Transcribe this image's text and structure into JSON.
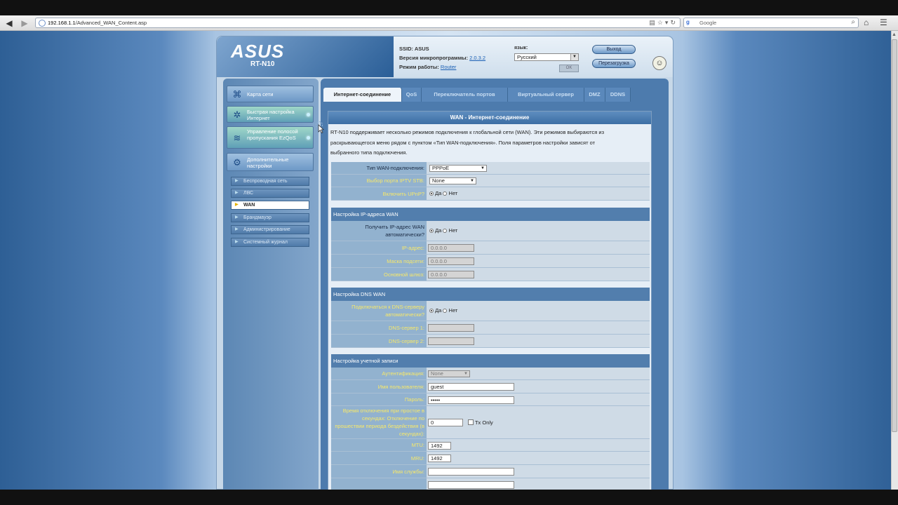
{
  "browser": {
    "url_host": "192.168.1.1",
    "url_path": "/Advanced_WAN_Content.asp",
    "search_placeholder": "Google",
    "search_engine_letter": "g"
  },
  "router": {
    "brand": "ASUS",
    "model": "RT-N10",
    "ssid_label": "SSID:",
    "ssid_value": "ASUS",
    "firmware_label": "Версия микропрограммы:",
    "firmware_value": "2.0.3.2",
    "mode_label": "Режим работы:",
    "mode_value": "Router",
    "language_label": "язык:",
    "language_value": "Русский",
    "apply_label": "OK",
    "logout_label": "Выход",
    "reboot_label": "Перезагрузка"
  },
  "sidebar": {
    "main": [
      {
        "label": "Карта сети",
        "icon": "network-map-icon"
      },
      {
        "label": "Быстрая настройка Интернет",
        "icon": "quick-setup-icon"
      },
      {
        "label": "Управление полосой пропускания EzQoS",
        "icon": "qos-icon"
      },
      {
        "label": "Дополнительные настройки",
        "icon": "advanced-settings-icon"
      }
    ],
    "sub": [
      {
        "label": "Беспроводная сеть"
      },
      {
        "label": "ЛВС"
      },
      {
        "label": "WAN"
      },
      {
        "label": "Брандмауэр"
      },
      {
        "label": "Администрирование"
      },
      {
        "label": "Системный журнал"
      }
    ]
  },
  "tabs": [
    {
      "label": "Интернет-соединение"
    },
    {
      "label": "QoS"
    },
    {
      "label": "Переключатель портов"
    },
    {
      "label": "Виртуальный сервер"
    },
    {
      "label": "DMZ"
    },
    {
      "label": "DDNS"
    }
  ],
  "panel": {
    "title": "WAN - Интернет-соединение",
    "desc_line1": "RT-N10 поддерживает несколько режимов подключения к глобальной сети (WAN). Эти режимов выбираются из",
    "desc_line2": "раскрывающегося меню рядом с пунктом «Тип WAN-подключения». Поля параметров настройки зависят от",
    "desc_line3": "выбранного типа подключения.",
    "wan_type_label": "Тип WAN-подключения:",
    "wan_type_value": "PPPoE",
    "iptv_label": "Выбор порта IPTV STB:",
    "iptv_value": "None",
    "upnp_label": "Включить UPnP?",
    "yes": "Да",
    "no": "Нет",
    "ip_section": "Настройка IP-адреса WAN",
    "auto_ip_label": "Получить IP-адрес WAN автоматически?",
    "ip_label": "IP-адрес:",
    "ip_value": "0.0.0.0",
    "mask_label": "Маска подсети:",
    "mask_value": "0.0.0.0",
    "gateway_label": "Основной шлюз:",
    "gateway_value": "0.0.0.0",
    "dns_section": "Настройка DNS WAN",
    "auto_dns_label": "Подключаться к DNS-серверу автоматически?",
    "dns1_label": "DNS-сервер 1:",
    "dns1_value": "",
    "dns2_label": "DNS-сервер 2:",
    "dns2_value": "",
    "account_section": "Настройка учетной записи",
    "auth_label": "Аутентификация:",
    "auth_value": "None",
    "user_label": "Имя пользователя:",
    "user_value": "guest",
    "pass_label": "Пароль:",
    "pass_value": "•••••",
    "idle_label": "Время отключения при простое в секундах: Отключение по прошествии периода бездействия (в секундах):",
    "idle_value": "0",
    "txonly_label": "Tx Only",
    "mtu_label": "MTU:",
    "mtu_value": "1492",
    "mru_label": "MRU:",
    "mru_value": "1492",
    "service_label": "Имя службы:",
    "service_value": ""
  }
}
